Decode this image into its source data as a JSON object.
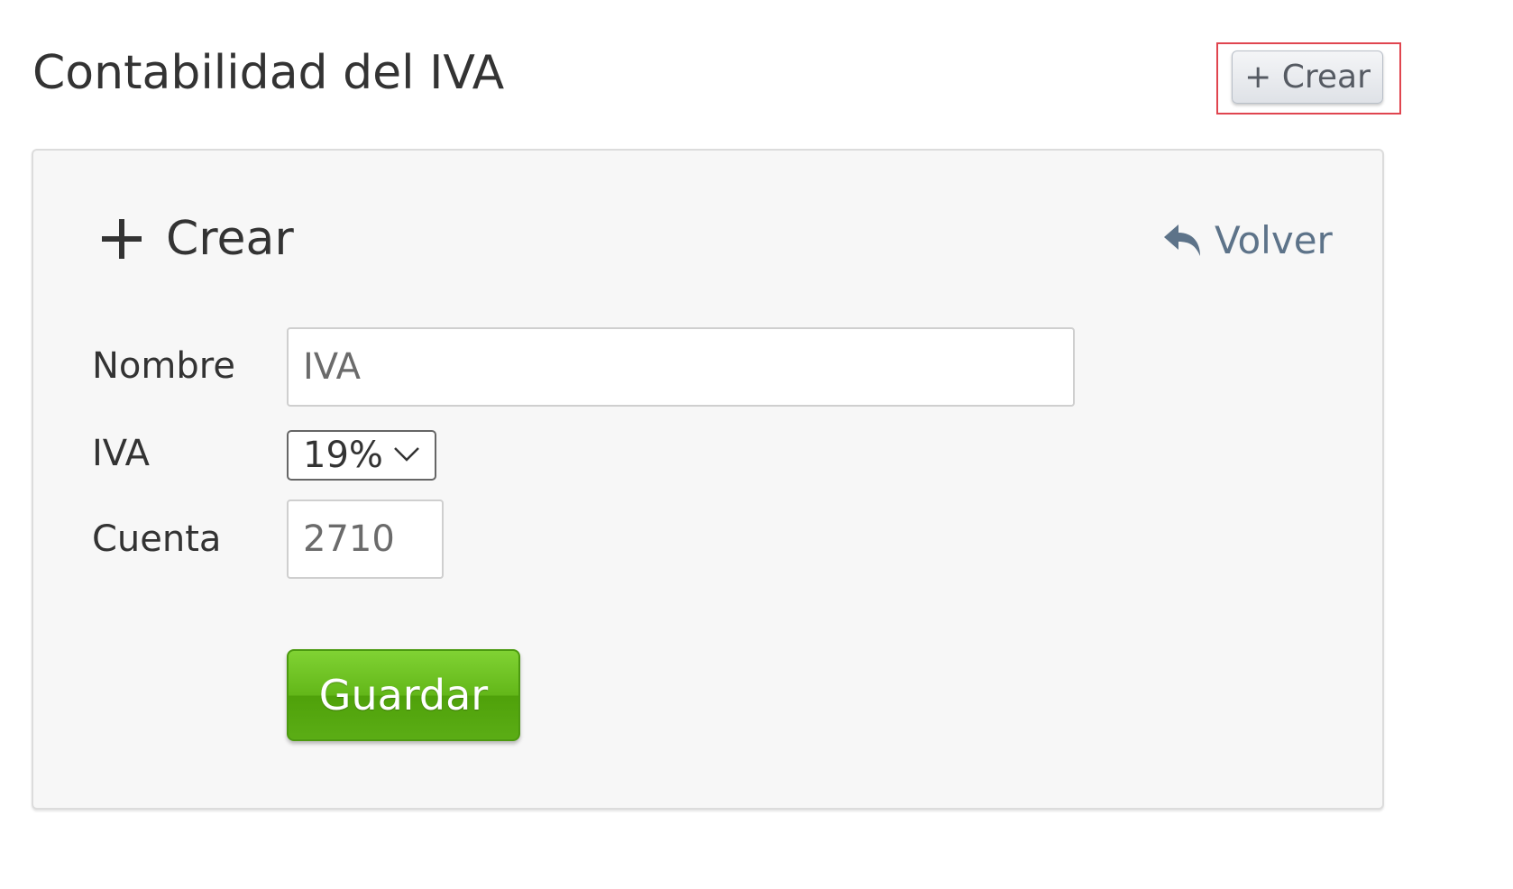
{
  "page": {
    "title": "Contabilidad del IVA",
    "create_button_label": "+ Crear"
  },
  "form": {
    "heading_icon": "plus-icon",
    "heading": "Crear",
    "back_icon": "reply-arrow-icon",
    "back_label": "Volver",
    "fields": {
      "nombre": {
        "label": "Nombre",
        "value": "IVA"
      },
      "iva": {
        "label": "IVA",
        "selected": "19%"
      },
      "cuenta": {
        "label": "Cuenta",
        "value": "2710"
      }
    },
    "save_label": "Guardar"
  },
  "colors": {
    "highlight_border": "#e0454f",
    "link": "#5d7389",
    "save_button": "#5bad15",
    "panel_background": "#f7f7f7"
  }
}
